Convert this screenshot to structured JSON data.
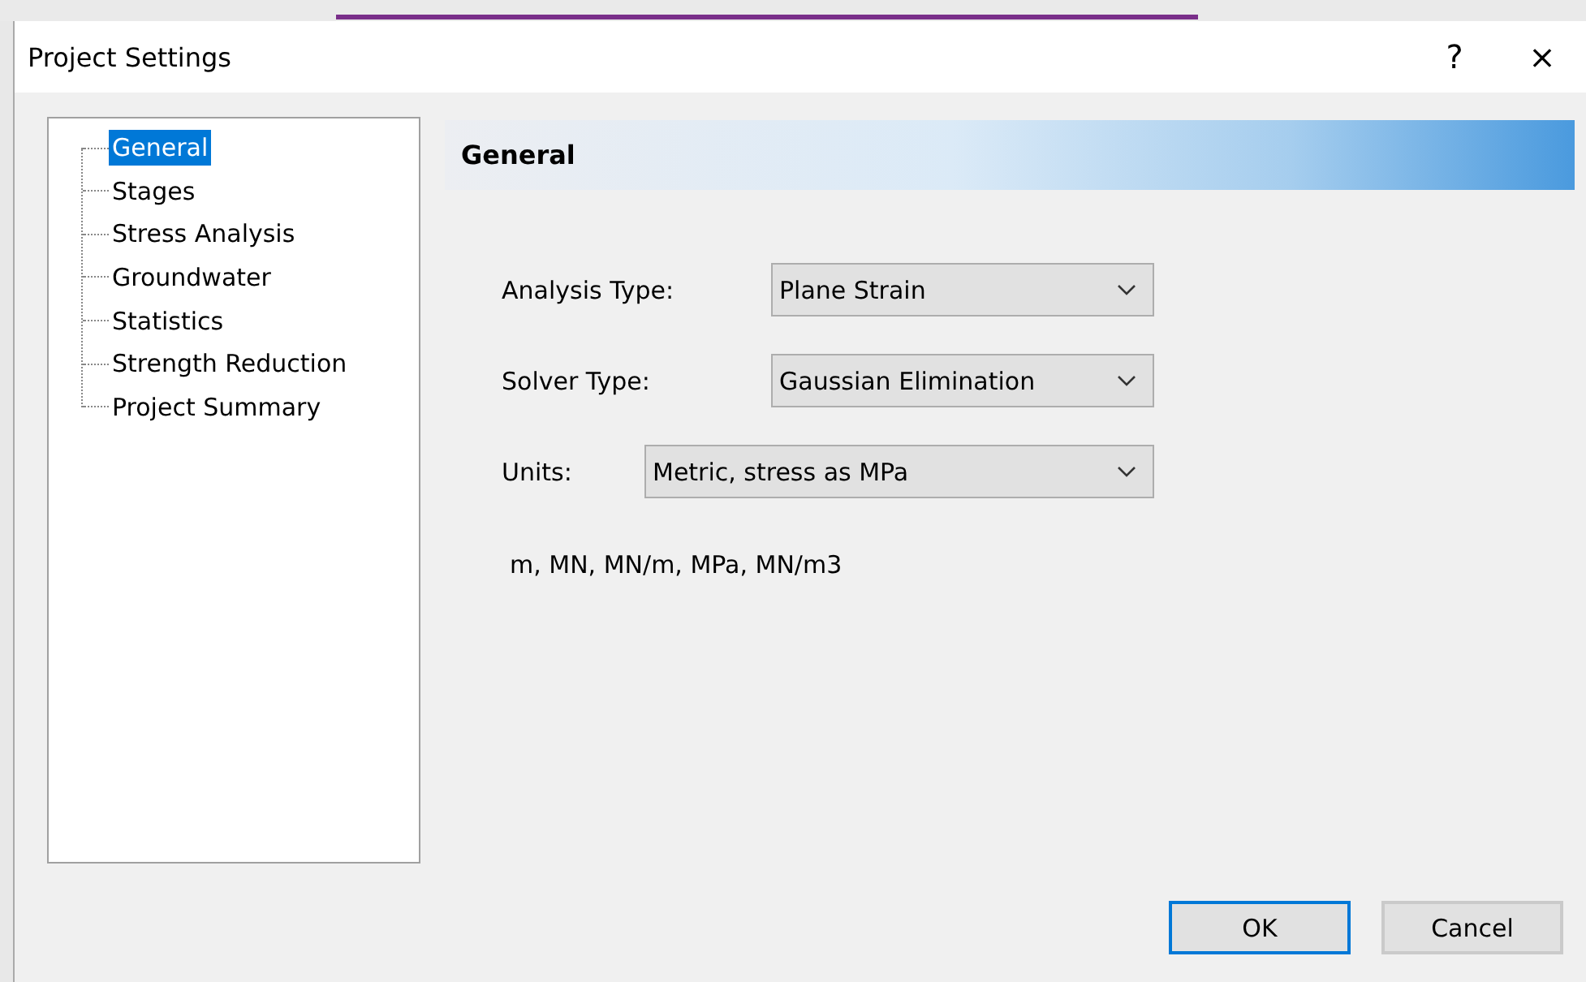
{
  "window": {
    "title": "Project Settings",
    "help": "?",
    "close": "×"
  },
  "tree": [
    {
      "label": "General",
      "selected": true
    },
    {
      "label": "Stages",
      "selected": false
    },
    {
      "label": "Stress Analysis",
      "selected": false
    },
    {
      "label": "Groundwater",
      "selected": false
    },
    {
      "label": "Statistics",
      "selected": false
    },
    {
      "label": "Strength Reduction",
      "selected": false
    },
    {
      "label": "Project Summary",
      "selected": false
    }
  ],
  "section": {
    "title": "General"
  },
  "fields": [
    {
      "label": "Analysis Type:",
      "value": "Plane Strain",
      "kind": "narrow"
    },
    {
      "label": "Solver Type:",
      "value": "Gaussian Elimination",
      "kind": "narrow"
    },
    {
      "label": "Units:",
      "value": "Metric, stress as MPa",
      "kind": "wide"
    }
  ],
  "units_note": "m, MN, MN/m, MPa, MN/m3",
  "buttons": [
    {
      "label": "OK",
      "default": true
    },
    {
      "label": "Cancel",
      "default": false
    }
  ]
}
